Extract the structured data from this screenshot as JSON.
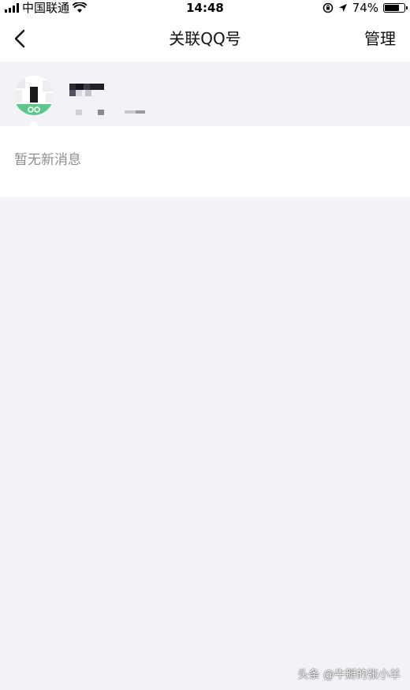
{
  "status_bar": {
    "carrier": "中国联通",
    "time": "14:48",
    "battery": "74%",
    "battery_level": 0.74,
    "icons": [
      "signal-icon",
      "wifi-icon",
      "orientation-lock-icon",
      "location-icon",
      "battery-icon"
    ]
  },
  "nav": {
    "back_icon": "chevron-left-icon",
    "title": "关联QQ号",
    "action": "管理"
  },
  "account": {
    "avatar_icon": "qq-avatar-icon",
    "name": "",
    "id": ""
  },
  "messages": {
    "empty_text": "暂无新消息"
  },
  "watermark": "头条 @牛掰的张小羊",
  "colors": {
    "background": "#f2f2f7",
    "panel": "#ffffff",
    "muted_text": "#8e8e93",
    "avatar_green": "#5cc88a"
  }
}
